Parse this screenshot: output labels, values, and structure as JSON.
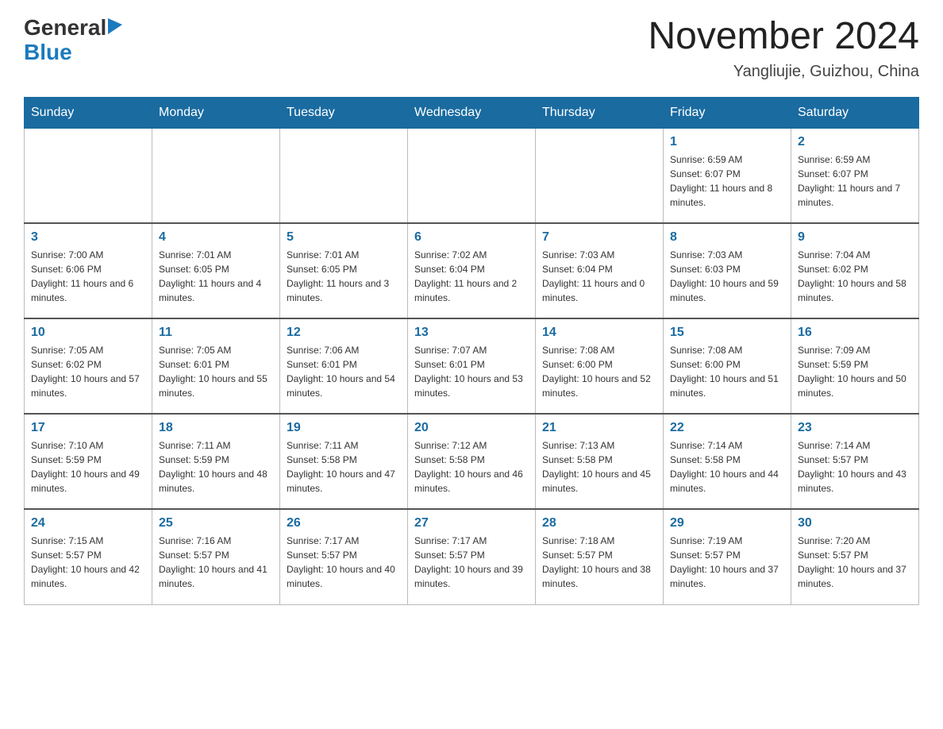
{
  "header": {
    "logo_general": "General",
    "logo_blue": "Blue",
    "month_title": "November 2024",
    "location": "Yangliujie, Guizhou, China"
  },
  "days_of_week": [
    "Sunday",
    "Monday",
    "Tuesday",
    "Wednesday",
    "Thursday",
    "Friday",
    "Saturday"
  ],
  "weeks": [
    [
      {
        "day": "",
        "sunrise": "",
        "sunset": "",
        "daylight": ""
      },
      {
        "day": "",
        "sunrise": "",
        "sunset": "",
        "daylight": ""
      },
      {
        "day": "",
        "sunrise": "",
        "sunset": "",
        "daylight": ""
      },
      {
        "day": "",
        "sunrise": "",
        "sunset": "",
        "daylight": ""
      },
      {
        "day": "",
        "sunrise": "",
        "sunset": "",
        "daylight": ""
      },
      {
        "day": "1",
        "sunrise": "Sunrise: 6:59 AM",
        "sunset": "Sunset: 6:07 PM",
        "daylight": "Daylight: 11 hours and 8 minutes."
      },
      {
        "day": "2",
        "sunrise": "Sunrise: 6:59 AM",
        "sunset": "Sunset: 6:07 PM",
        "daylight": "Daylight: 11 hours and 7 minutes."
      }
    ],
    [
      {
        "day": "3",
        "sunrise": "Sunrise: 7:00 AM",
        "sunset": "Sunset: 6:06 PM",
        "daylight": "Daylight: 11 hours and 6 minutes."
      },
      {
        "day": "4",
        "sunrise": "Sunrise: 7:01 AM",
        "sunset": "Sunset: 6:05 PM",
        "daylight": "Daylight: 11 hours and 4 minutes."
      },
      {
        "day": "5",
        "sunrise": "Sunrise: 7:01 AM",
        "sunset": "Sunset: 6:05 PM",
        "daylight": "Daylight: 11 hours and 3 minutes."
      },
      {
        "day": "6",
        "sunrise": "Sunrise: 7:02 AM",
        "sunset": "Sunset: 6:04 PM",
        "daylight": "Daylight: 11 hours and 2 minutes."
      },
      {
        "day": "7",
        "sunrise": "Sunrise: 7:03 AM",
        "sunset": "Sunset: 6:04 PM",
        "daylight": "Daylight: 11 hours and 0 minutes."
      },
      {
        "day": "8",
        "sunrise": "Sunrise: 7:03 AM",
        "sunset": "Sunset: 6:03 PM",
        "daylight": "Daylight: 10 hours and 59 minutes."
      },
      {
        "day": "9",
        "sunrise": "Sunrise: 7:04 AM",
        "sunset": "Sunset: 6:02 PM",
        "daylight": "Daylight: 10 hours and 58 minutes."
      }
    ],
    [
      {
        "day": "10",
        "sunrise": "Sunrise: 7:05 AM",
        "sunset": "Sunset: 6:02 PM",
        "daylight": "Daylight: 10 hours and 57 minutes."
      },
      {
        "day": "11",
        "sunrise": "Sunrise: 7:05 AM",
        "sunset": "Sunset: 6:01 PM",
        "daylight": "Daylight: 10 hours and 55 minutes."
      },
      {
        "day": "12",
        "sunrise": "Sunrise: 7:06 AM",
        "sunset": "Sunset: 6:01 PM",
        "daylight": "Daylight: 10 hours and 54 minutes."
      },
      {
        "day": "13",
        "sunrise": "Sunrise: 7:07 AM",
        "sunset": "Sunset: 6:01 PM",
        "daylight": "Daylight: 10 hours and 53 minutes."
      },
      {
        "day": "14",
        "sunrise": "Sunrise: 7:08 AM",
        "sunset": "Sunset: 6:00 PM",
        "daylight": "Daylight: 10 hours and 52 minutes."
      },
      {
        "day": "15",
        "sunrise": "Sunrise: 7:08 AM",
        "sunset": "Sunset: 6:00 PM",
        "daylight": "Daylight: 10 hours and 51 minutes."
      },
      {
        "day": "16",
        "sunrise": "Sunrise: 7:09 AM",
        "sunset": "Sunset: 5:59 PM",
        "daylight": "Daylight: 10 hours and 50 minutes."
      }
    ],
    [
      {
        "day": "17",
        "sunrise": "Sunrise: 7:10 AM",
        "sunset": "Sunset: 5:59 PM",
        "daylight": "Daylight: 10 hours and 49 minutes."
      },
      {
        "day": "18",
        "sunrise": "Sunrise: 7:11 AM",
        "sunset": "Sunset: 5:59 PM",
        "daylight": "Daylight: 10 hours and 48 minutes."
      },
      {
        "day": "19",
        "sunrise": "Sunrise: 7:11 AM",
        "sunset": "Sunset: 5:58 PM",
        "daylight": "Daylight: 10 hours and 47 minutes."
      },
      {
        "day": "20",
        "sunrise": "Sunrise: 7:12 AM",
        "sunset": "Sunset: 5:58 PM",
        "daylight": "Daylight: 10 hours and 46 minutes."
      },
      {
        "day": "21",
        "sunrise": "Sunrise: 7:13 AM",
        "sunset": "Sunset: 5:58 PM",
        "daylight": "Daylight: 10 hours and 45 minutes."
      },
      {
        "day": "22",
        "sunrise": "Sunrise: 7:14 AM",
        "sunset": "Sunset: 5:58 PM",
        "daylight": "Daylight: 10 hours and 44 minutes."
      },
      {
        "day": "23",
        "sunrise": "Sunrise: 7:14 AM",
        "sunset": "Sunset: 5:57 PM",
        "daylight": "Daylight: 10 hours and 43 minutes."
      }
    ],
    [
      {
        "day": "24",
        "sunrise": "Sunrise: 7:15 AM",
        "sunset": "Sunset: 5:57 PM",
        "daylight": "Daylight: 10 hours and 42 minutes."
      },
      {
        "day": "25",
        "sunrise": "Sunrise: 7:16 AM",
        "sunset": "Sunset: 5:57 PM",
        "daylight": "Daylight: 10 hours and 41 minutes."
      },
      {
        "day": "26",
        "sunrise": "Sunrise: 7:17 AM",
        "sunset": "Sunset: 5:57 PM",
        "daylight": "Daylight: 10 hours and 40 minutes."
      },
      {
        "day": "27",
        "sunrise": "Sunrise: 7:17 AM",
        "sunset": "Sunset: 5:57 PM",
        "daylight": "Daylight: 10 hours and 39 minutes."
      },
      {
        "day": "28",
        "sunrise": "Sunrise: 7:18 AM",
        "sunset": "Sunset: 5:57 PM",
        "daylight": "Daylight: 10 hours and 38 minutes."
      },
      {
        "day": "29",
        "sunrise": "Sunrise: 7:19 AM",
        "sunset": "Sunset: 5:57 PM",
        "daylight": "Daylight: 10 hours and 37 minutes."
      },
      {
        "day": "30",
        "sunrise": "Sunrise: 7:20 AM",
        "sunset": "Sunset: 5:57 PM",
        "daylight": "Daylight: 10 hours and 37 minutes."
      }
    ]
  ]
}
